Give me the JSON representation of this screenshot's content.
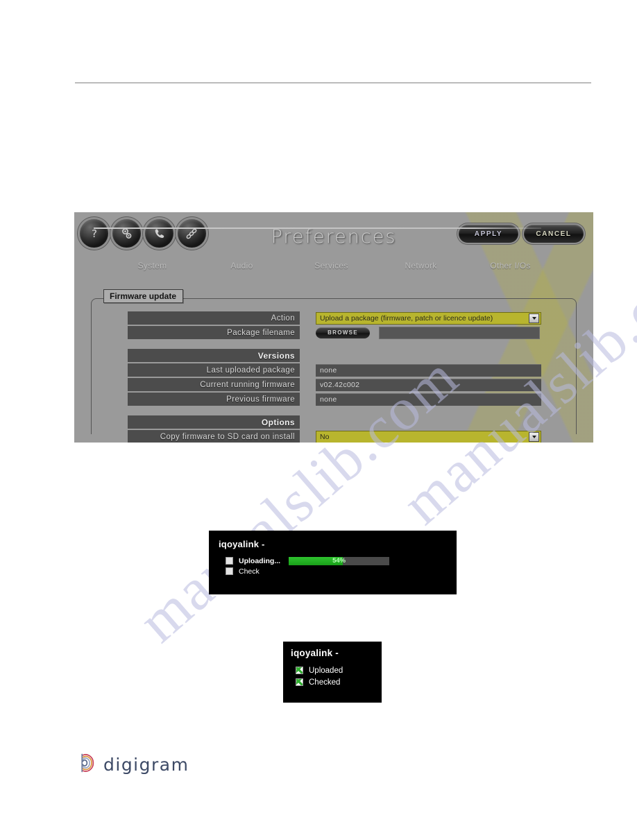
{
  "page": {
    "watermark_text": "manualslib.com"
  },
  "device_ui": {
    "title": "Preferences",
    "header_icons": [
      {
        "name": "help-icon",
        "label": "?"
      },
      {
        "name": "gears-icon",
        "label": "gears"
      },
      {
        "name": "phone-icon",
        "label": "phone"
      },
      {
        "name": "chain-link-icon",
        "label": "link"
      }
    ],
    "actions": {
      "apply_label": "APPLY",
      "cancel_label": "CANCEL"
    },
    "tabs": [
      {
        "label": "System",
        "active": true
      },
      {
        "label": "Audio",
        "active": false
      },
      {
        "label": "Services",
        "active": false
      },
      {
        "label": "Network",
        "active": false
      },
      {
        "label": "Other I/Os",
        "active": false
      }
    ],
    "group": {
      "legend": "Firmware update",
      "action_row": {
        "label": "Action",
        "value": "Upload a package (firmware, patch or licence update)"
      },
      "package_row": {
        "label": "Package filename",
        "browse_label": "BROWSE",
        "filename_value": ""
      },
      "versions": {
        "section_label": "Versions",
        "rows": [
          {
            "label": "Last uploaded package",
            "value": "none"
          },
          {
            "label": "Current running firmware",
            "value": "v02.42c002"
          },
          {
            "label": "Previous firmware",
            "value": "none"
          }
        ]
      },
      "options": {
        "section_label": "Options",
        "rows": [
          {
            "label": "Copy firmware to SD card on install",
            "value": "No"
          }
        ]
      }
    },
    "colors": {
      "panel_bg": "#9a9a9a",
      "select_bg": "#b8b52e",
      "label_bg": "#4c4c4c",
      "progress_green": "#2fc22f"
    }
  },
  "dialog_uploading": {
    "title": "iqoyalink -",
    "rows": [
      {
        "label": "Uploading...",
        "checked": false,
        "has_progress": true
      },
      {
        "label": "Check",
        "checked": false,
        "has_progress": false
      }
    ],
    "progress_percent": 54,
    "progress_text": "54%"
  },
  "dialog_done": {
    "title": "iqoyalink -",
    "rows": [
      {
        "label": "Uploaded",
        "checked": true
      },
      {
        "label": "Checked",
        "checked": true
      }
    ]
  },
  "footer": {
    "brand": "digigram"
  }
}
